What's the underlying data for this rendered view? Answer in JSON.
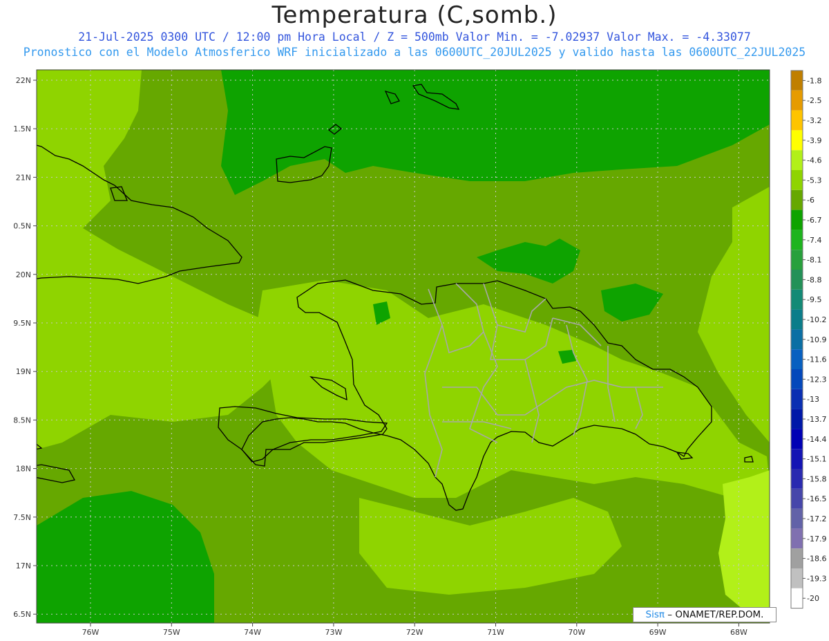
{
  "header": {
    "title": "Temperatura (C,somb.)",
    "subtitle_1": "21-Jul-2025  0300 UTC / 12:00 pm Hora Local / Z = 500mb  Valor Min. = -7.02937  Valor Max. = -4.33077",
    "subtitle_2": "Pronostico con el Modelo Atmosferico WRF inicializado a las 0600UTC_20JUL2025 y valido hasta las  0600UTC_22JUL2025"
  },
  "map": {
    "lat_labels": [
      "22N",
      "1.5N",
      "21N",
      "0.5N",
      "20N",
      "9.5N",
      "19N",
      "8.5N",
      "18N",
      "7.5N",
      "17N",
      "6.5N"
    ],
    "lon_labels": [
      "76W",
      "75W",
      "74W",
      "73W",
      "72W",
      "71W",
      "70W",
      "69W",
      "68W"
    ],
    "colors": {
      "background_field": "#66a800",
      "light_field": "#8fd400",
      "dark_field": "#0ea300",
      "brightest_field": "#b2f019",
      "coast": "#000000",
      "provinces": "#a8a8a8",
      "grid": "#c8c8c8"
    }
  },
  "colorbar": {
    "labels": [
      "-1.8",
      "-2.5",
      "-3.2",
      "-3.9",
      "-4.6",
      "-5.3",
      "-6",
      "-6.7",
      "-7.4",
      "-8.1",
      "-8.8",
      "-9.5",
      "-10.2",
      "-10.9",
      "-11.6",
      "-12.3",
      "-13",
      "-13.7",
      "-14.4",
      "-15.1",
      "-15.8",
      "-16.5",
      "-17.2",
      "-17.9",
      "-18.6",
      "-19.3",
      "-20"
    ],
    "colors": [
      "#c07f00",
      "#e69b00",
      "#ffc400",
      "#ffff00",
      "#b2f019",
      "#8fd400",
      "#66a800",
      "#0ea300",
      "#1eb41e",
      "#28a03c",
      "#239158",
      "#138a76",
      "#0b7d8a",
      "#0b6fa4",
      "#0860c0",
      "#0448bb",
      "#0a2fb2",
      "#0018a8",
      "#0000b4",
      "#1414b4",
      "#2a2ab0",
      "#4646aa",
      "#6262a8",
      "#8070b0",
      "#a0a0a0",
      "#c0c0c0",
      "#ffffff"
    ]
  },
  "credit": {
    "sis": "Sisπ",
    "text": "– ONAMET/REP.DOM."
  }
}
